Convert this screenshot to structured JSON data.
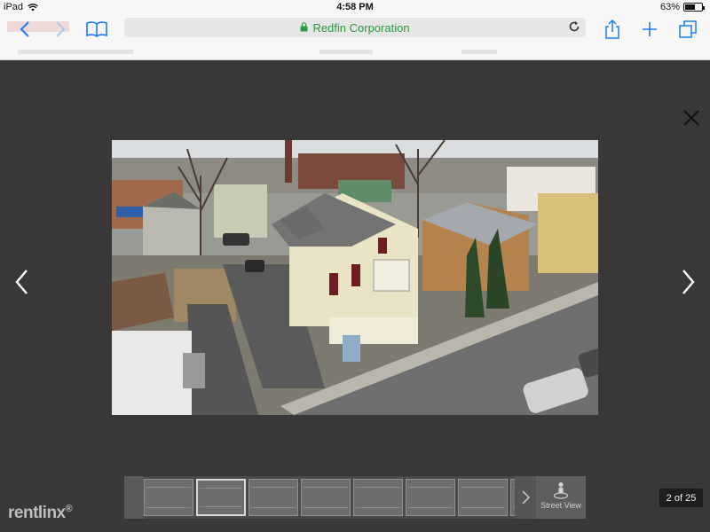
{
  "status_bar": {
    "device": "iPad",
    "time": "4:58 PM",
    "battery_text": "63%",
    "battery_level": 0.63
  },
  "browser": {
    "address_text": "Redfin Corporation",
    "security_color": "#2c9a3c",
    "accent_color": "#1a7cf5",
    "icons": [
      "back-icon",
      "forward-icon",
      "bookmarks-icon",
      "lock-icon",
      "reload-icon",
      "share-icon",
      "new-tab-icon",
      "tabs-icon"
    ]
  },
  "viewer": {
    "background_color": "#383838",
    "photo_subject": "aerial-house-photo",
    "counter": "2 of 25",
    "street_view_label": "Street View",
    "thumbnail_count_visible": 8,
    "active_thumbnail_index": 1
  },
  "watermark": {
    "text": "rentlinx"
  }
}
